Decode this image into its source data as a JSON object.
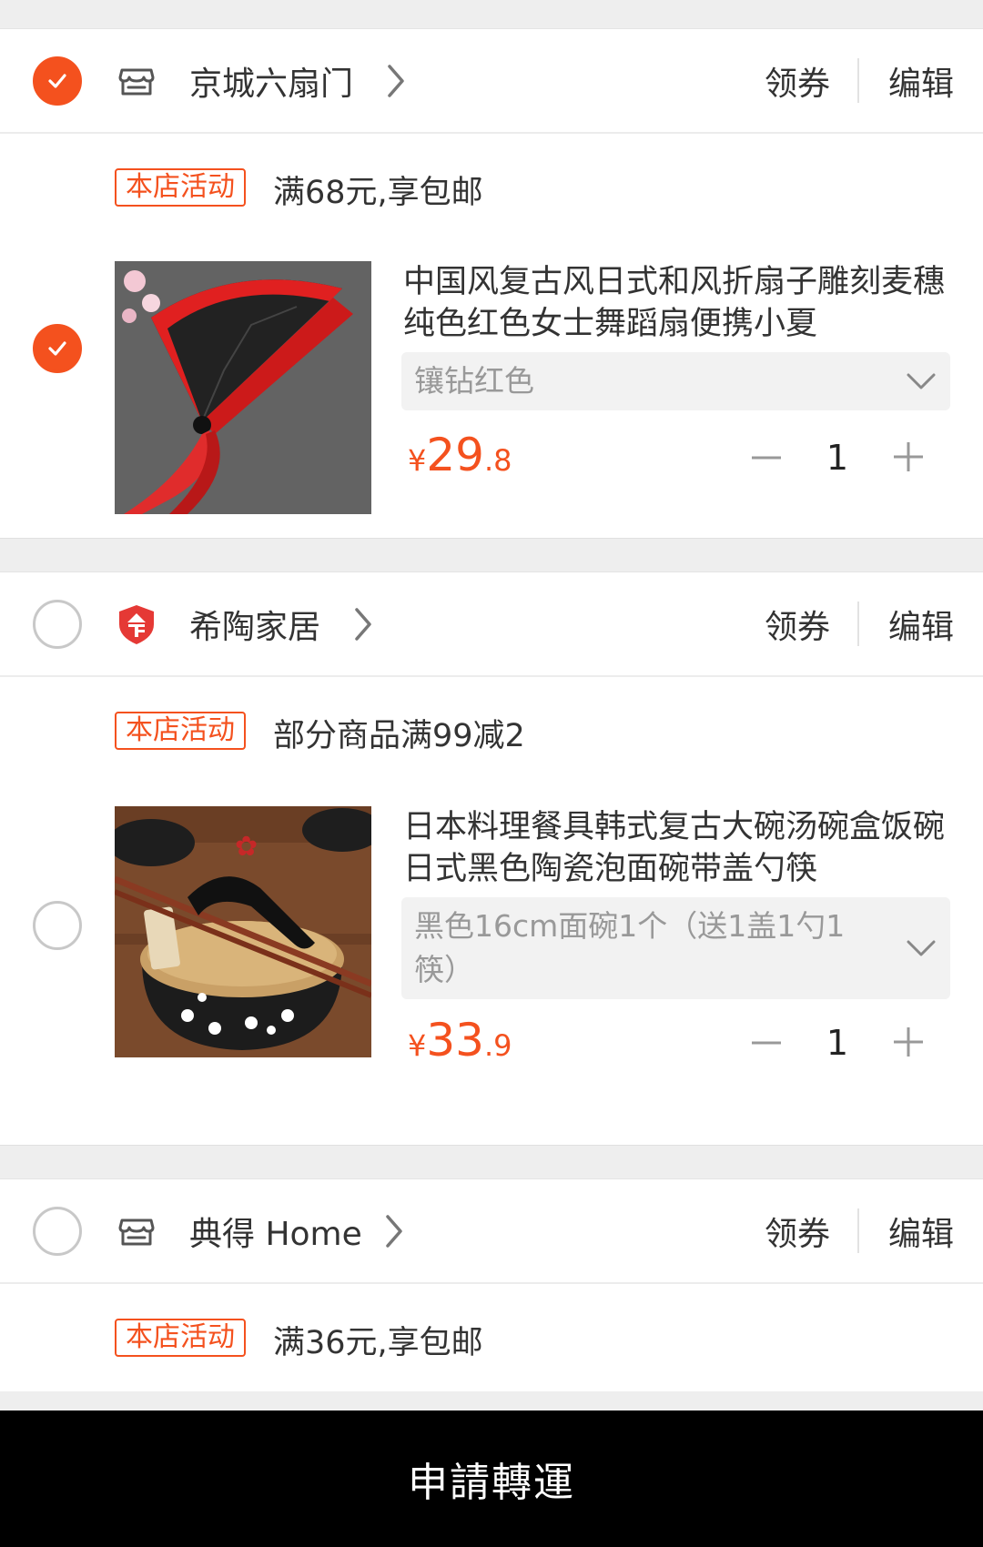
{
  "stores": [
    {
      "name": "京城六扇门",
      "checked": true,
      "icon": "shop-icon",
      "coupon_label": "领券",
      "edit_label": "编辑",
      "promo_tag": "本店活动",
      "promo_text": "满68元,享包邮",
      "item": {
        "checked": true,
        "title": "中国风复古风日式和风折扇子雕刻麦穗纯色红色女士舞蹈扇便携小夏",
        "spec": "镶钻红色",
        "currency": "¥",
        "price_int": "29",
        "price_dec": ".8",
        "quantity": "1",
        "image": "folding-fan-photo"
      }
    },
    {
      "name": "希陶家居",
      "checked": false,
      "icon": "enterprise-badge-icon",
      "coupon_label": "领券",
      "edit_label": "编辑",
      "promo_tag": "本店活动",
      "promo_text": "部分商品满99减2",
      "item": {
        "checked": false,
        "title": "日本料理餐具韩式复古大碗汤碗盒饭碗日式黑色陶瓷泡面碗带盖勺筷",
        "spec": "黑色16cm面碗1个（送1盖1勺1筷）",
        "currency": "¥",
        "price_int": "33",
        "price_dec": ".9",
        "quantity": "1",
        "image": "ceramic-bowl-photo"
      }
    },
    {
      "name": "典得 Home",
      "checked": false,
      "icon": "shop-icon",
      "coupon_label": "领券",
      "edit_label": "编辑",
      "promo_tag": "本店活动",
      "promo_text": "满36元,享包邮"
    }
  ],
  "bottom_bar": {
    "label": "申請轉運"
  },
  "colors": {
    "accent": "#f4511e",
    "bar": "#000000"
  }
}
